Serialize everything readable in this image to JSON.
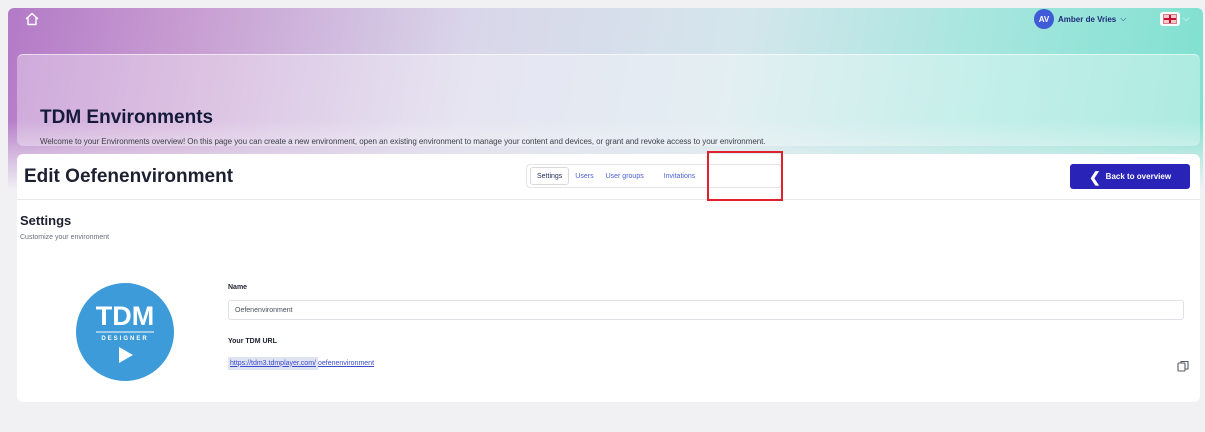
{
  "header": {
    "user_name": "Amber de Vries",
    "user_initials": "AV",
    "language": "English",
    "icons": [
      "home-icon",
      "chevron-down-icon",
      "uk-flag-icon"
    ]
  },
  "hero": {
    "title": "TDM Environments",
    "description": "Welcome to your Environments overview! On this page you can create a new environment, open an existing environment to manage your content and devices, or grant and revoke access to your environment."
  },
  "panel": {
    "title": "Edit Oefenenvironment",
    "tabs": [
      {
        "label": "Settings",
        "active": true
      },
      {
        "label": "Users",
        "active": false
      },
      {
        "label": "User groups",
        "active": false
      },
      {
        "label": "Invitations",
        "active": false
      }
    ],
    "back_button": "Back to overview"
  },
  "settings": {
    "title": "Settings",
    "subtitle": "Customize your environment",
    "logo": {
      "text": "TDM",
      "subtext": "DESIGNER"
    },
    "name_label": "Name",
    "name_value": "Oefenenvironment",
    "url_label": "Your TDM URL",
    "url_prefix": "https://tdm3.tdmplayer.com/",
    "url_suffix": "oefenenvironment"
  },
  "colors": {
    "primary": "#2a23b8",
    "link": "#3b4bd0",
    "highlight_box": "#e0202a",
    "logo_blue": "#3d9bd9"
  }
}
